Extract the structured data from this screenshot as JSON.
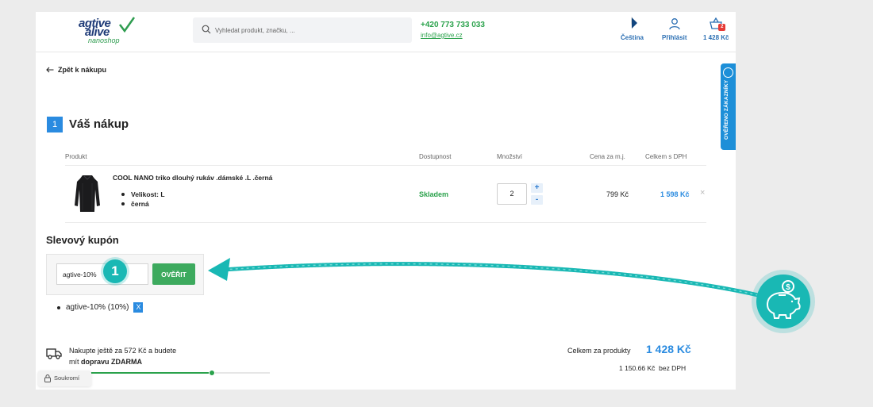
{
  "header": {
    "logo": {
      "line1": "agtive",
      "line2": "alive",
      "line3": "nanoshop"
    },
    "search_placeholder": "Vyhledat produkt, značku, ...",
    "phone": "+420 773 733 033",
    "email": "info@agtive.cz",
    "language_label": "Čeština",
    "login_label": "Přihlásit",
    "cart_total": "1 428 Kč",
    "cart_count": "2"
  },
  "back_link": "Zpět k nákupu",
  "step": {
    "number": "1",
    "title": "Váš nákup"
  },
  "table": {
    "columns": [
      "Produkt",
      "Dostupnost",
      "Množství",
      "Cena za m.j.",
      "Celkem s DPH"
    ],
    "rows": [
      {
        "name": "COOL NANO triko dlouhý rukáv .dámské .L .černá",
        "attributes": [
          "Velikost: L",
          "černá"
        ],
        "availability": "Skladem",
        "quantity": "2",
        "unit_price": "799 Kč",
        "total": "1 598 Kč"
      }
    ],
    "plus": "+",
    "minus": "-",
    "remove": "×"
  },
  "coupon": {
    "title": "Slevový kupón",
    "input_value": "agtive-10%",
    "button_label": "OVĚŘIT",
    "applied": "agtive-10% (10%)",
    "applied_remove": "X"
  },
  "annotation": {
    "callout_number": "1",
    "color": "#19b8b4"
  },
  "shipping": {
    "line1": "Nakupte ještě za 572 Kč a budete",
    "line2_prefix": "mít ",
    "line2_bold": "dopravu ZDARMA",
    "progress": 0.71
  },
  "privacy_label": "Soukromí",
  "summary": {
    "total_label": "Celkem za produkty",
    "total_value": "1 428 Kč",
    "net_value": "1 150.66 Kč",
    "net_label": "bez DPH"
  },
  "side_tab_label": "OVĚŘENO ZÁKAZNÍKY",
  "colors": {
    "accent": "#2a8be0",
    "green": "#2ba24c",
    "brand": "#1f3b78"
  }
}
